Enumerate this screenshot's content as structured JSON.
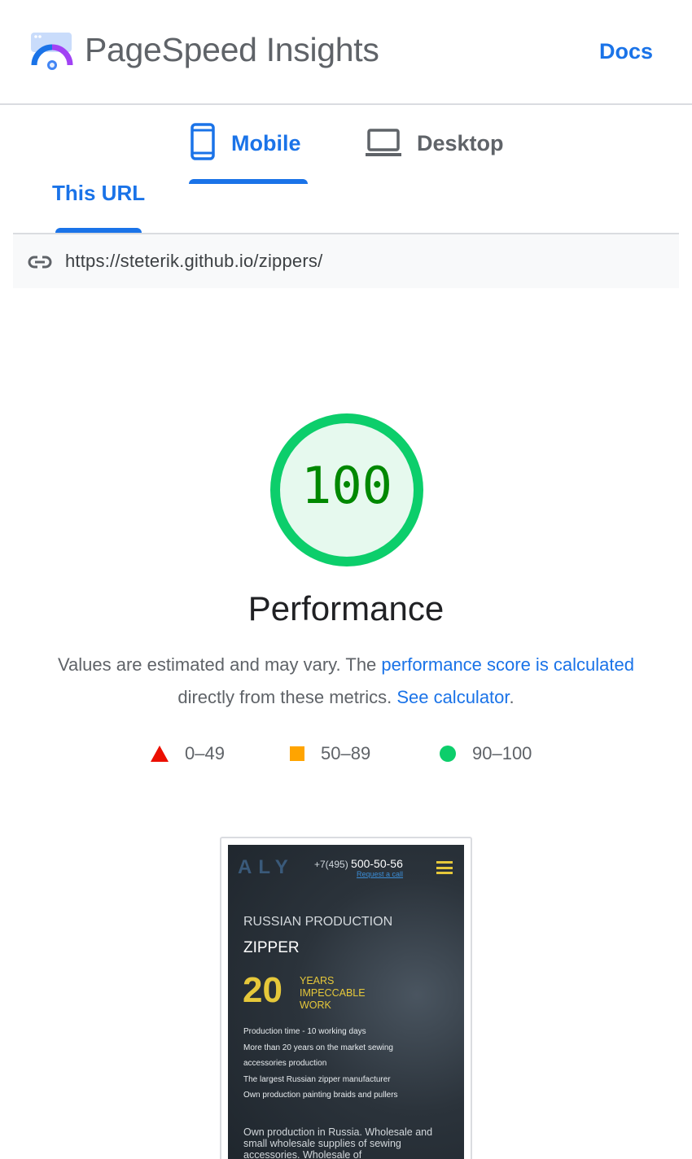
{
  "header": {
    "app_title": "PageSpeed Insights",
    "docs_label": "Docs"
  },
  "device_tabs": [
    {
      "label": "Mobile",
      "icon": "phone-icon",
      "selected": true
    },
    {
      "label": "Desktop",
      "icon": "laptop-icon",
      "selected": false
    }
  ],
  "url_tabs": {
    "this_url_label": "This URL"
  },
  "url_bar": {
    "icon": "link-icon",
    "url": "https://steterik.github.io/zippers/"
  },
  "performance": {
    "score": "100",
    "score_fraction": 1.0,
    "title": "Performance",
    "desc_prefix": "Values are estimated and may vary. The ",
    "desc_link": "performance score is calculated",
    "desc_middle": " directly from these metrics. ",
    "calc_link": "See calculator",
    "desc_suffix": "."
  },
  "legend": [
    {
      "label": "0–49",
      "shape": "triangle",
      "color": "#eb0f00"
    },
    {
      "label": "50–89",
      "shape": "square",
      "color": "#ffa400"
    },
    {
      "label": "90–100",
      "shape": "circle",
      "color": "#0cce6b"
    }
  ],
  "colors": {
    "accent": "#1a73e8",
    "pass_ring": "#0cce6b",
    "pass_fill": "#e6f9ee",
    "pass_text": "#008800"
  },
  "screenshot": {
    "logo": "ALY",
    "phone_prefix": "+7(495) ",
    "phone_number": "500-50-56",
    "request_call": "Request a call",
    "kicker": "RUSSIAN PRODUCTION",
    "headline": "ZIPPER",
    "years_number": "20",
    "years_line1": "YEARS",
    "years_line2": "IMPECCABLE",
    "years_line3": "WORK",
    "facts": [
      "Production time - 10 working days",
      "More than 20 years on the market sewing",
      "accessories production",
      "The largest Russian zipper manufacturer",
      "Own production painting braids and pullers"
    ],
    "own_text": "Own production in Russia. Wholesale and small wholesale supplies of sewing accessories. Wholesale of"
  }
}
